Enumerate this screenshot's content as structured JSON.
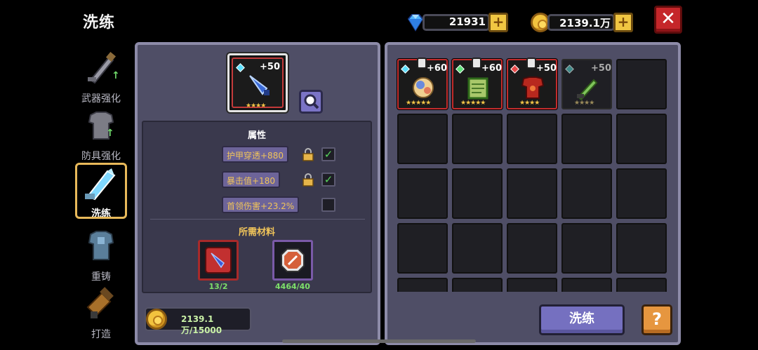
{
  "header": {
    "title": "洗练",
    "gems": "21931",
    "gold": "2139.1万",
    "close_label": "✕"
  },
  "nav": {
    "items": [
      {
        "label": "武器强化",
        "icon": "sword-upgrade-icon",
        "active": false
      },
      {
        "label": "防具强化",
        "icon": "armor-upgrade-icon",
        "active": false
      },
      {
        "label": "洗练",
        "icon": "refine-icon",
        "active": true
      },
      {
        "label": "重铸",
        "icon": "recast-icon",
        "active": false
      },
      {
        "label": "打造",
        "icon": "forge-icon",
        "active": false
      }
    ]
  },
  "selected": {
    "level": "+50",
    "stars": "★★★★"
  },
  "attributes": {
    "title": "属性",
    "rows": [
      {
        "text": "护甲穿透+880",
        "locked": true,
        "checked": true
      },
      {
        "text": "暴击值+180",
        "locked": true,
        "checked": true
      },
      {
        "text": "首领伤害+23.2%",
        "locked": false,
        "checked": false
      }
    ]
  },
  "materials": {
    "title": "所需材料",
    "items": [
      {
        "count": "13/2"
      },
      {
        "count": "4464/40"
      }
    ]
  },
  "cost": "2139.1万/15000",
  "inventory": [
    {
      "level": "+60",
      "stars": "★★★★★",
      "gem": "blue",
      "item": "rainbow-orb-icon"
    },
    {
      "level": "+60",
      "stars": "★★★★★",
      "gem": "green",
      "item": "green-scroll-icon"
    },
    {
      "level": "+50",
      "stars": "★★★★",
      "gem": "red",
      "item": "red-armor-icon"
    },
    {
      "level": "+50",
      "stars": "★★★★",
      "gem": "teal",
      "item": "green-sword-icon"
    }
  ],
  "buttons": {
    "refine": "洗练",
    "help": "?"
  },
  "colors": {
    "panel": "#4f4e66",
    "accent_gold": "#f0c642",
    "rarity_red": "#c22c2c",
    "check_green": "#58d45c"
  }
}
